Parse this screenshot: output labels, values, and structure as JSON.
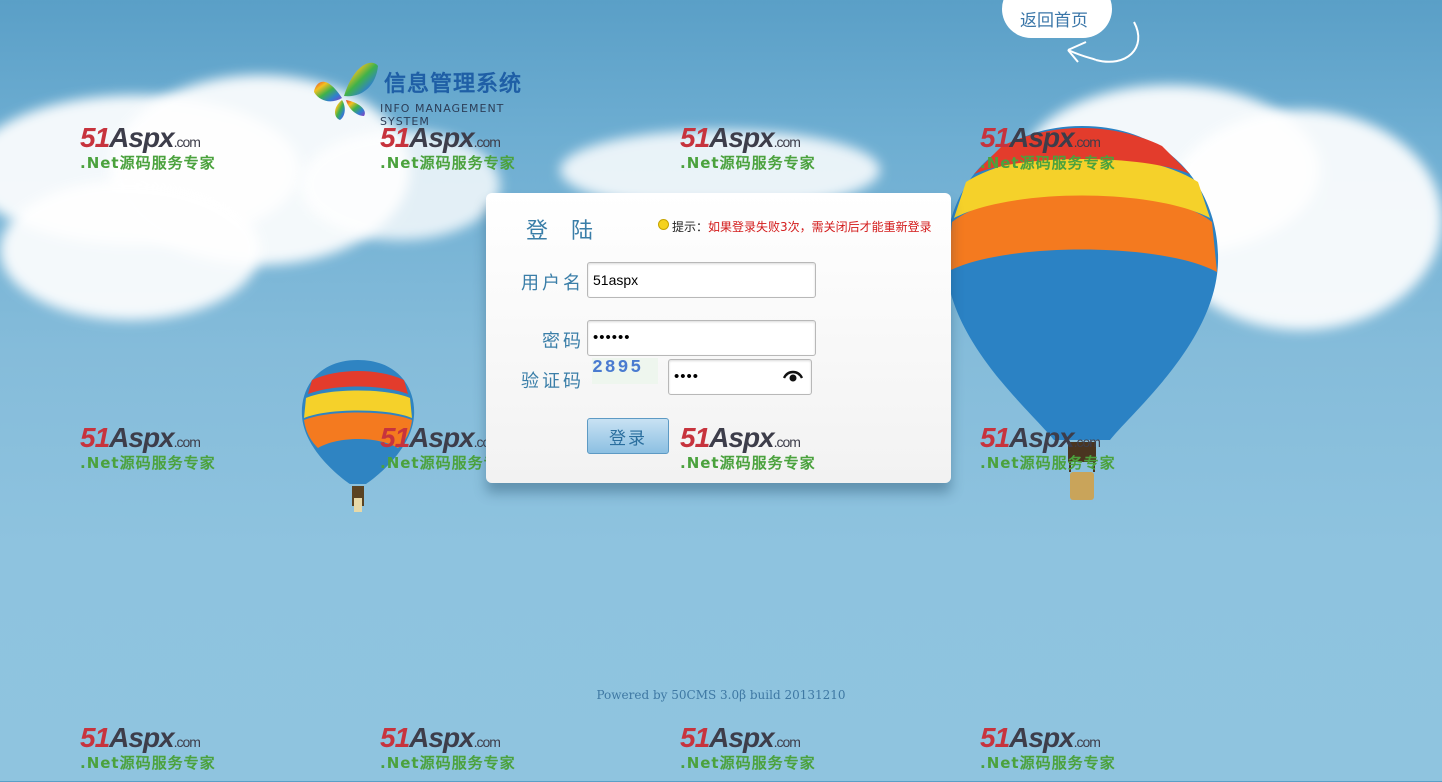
{
  "header": {
    "logo_title": "信息管理系统",
    "logo_subtitle": "INFO MANAGEMENT SYSTEM",
    "home_link": "返回首页"
  },
  "watermark": {
    "brand_number": "51",
    "brand_name": "Aspx",
    "brand_domain": ".com",
    "tagline": ".Net源码服务专家"
  },
  "login": {
    "title": "登 陆",
    "tip_label": "提示：",
    "tip_text": "如果登录失败3次，需关闭后才能重新登录",
    "username_label": "用户名",
    "username_value": "51aspx",
    "password_label": "密码",
    "password_value": "••••••",
    "captcha_label": "验证码",
    "captcha_image_text": "2895",
    "captcha_value": "••••",
    "submit_label": "登录"
  },
  "footer": {
    "text": "Powered by 50CMS 3.0β build 20131210"
  },
  "colors": {
    "sky": "#7fb8d8",
    "label_blue": "#3a7ea8",
    "tip_red": "#d31b1b",
    "brand_red": "#c7333d",
    "brand_green": "#4ba23d"
  }
}
